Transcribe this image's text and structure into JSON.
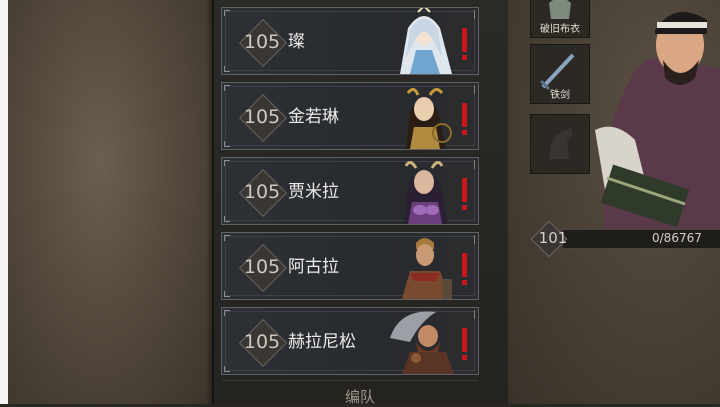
{
  "hero_list": [
    {
      "level": "105",
      "name": "璨",
      "alert": true
    },
    {
      "level": "105",
      "name": "金若琳",
      "alert": true
    },
    {
      "level": "105",
      "name": "贾米拉",
      "alert": true
    },
    {
      "level": "105",
      "name": "阿古拉",
      "alert": true
    },
    {
      "level": "105",
      "name": "赫拉尼松",
      "alert": true
    }
  ],
  "team_button": {
    "label": "编队"
  },
  "equipment": {
    "armor": {
      "label": "破旧布衣"
    },
    "weapon": {
      "label": "铁剑"
    },
    "mount": {
      "label": ""
    }
  },
  "main_hero": {
    "level": "101",
    "exp": "0/86767"
  },
  "colors": {
    "alert": "#c8161b",
    "card_border": "#5d6168",
    "level_text": "#cfc9bf"
  }
}
